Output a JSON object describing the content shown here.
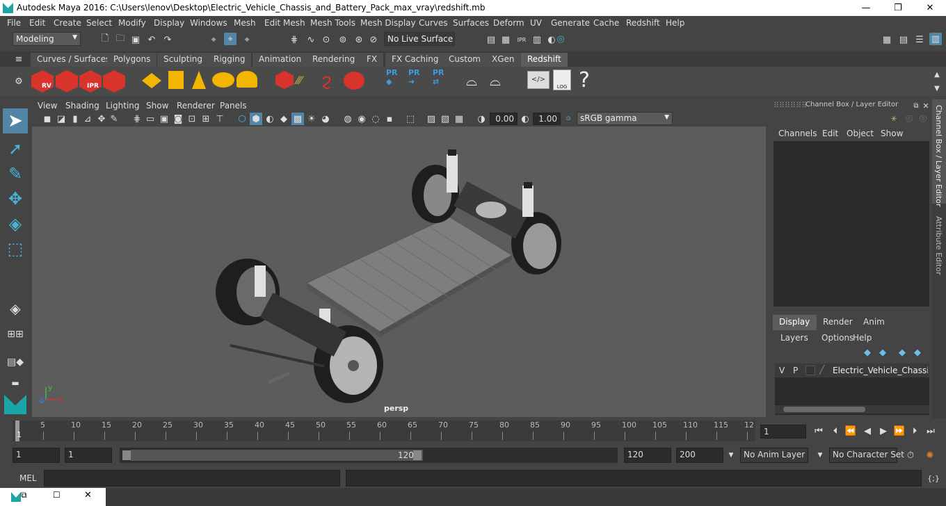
{
  "window": {
    "title": "Autodesk Maya 2016: C:\\Users\\lenov\\Desktop\\Electric_Vehicle_Chassis_and_Battery_Pack_max_vray\\redshift.mb"
  },
  "menubar": [
    "File",
    "Edit",
    "Create",
    "Select",
    "Modify",
    "Display",
    "Windows",
    "Mesh",
    "Edit Mesh",
    "Mesh Tools",
    "Mesh Display",
    "Curves",
    "Surfaces",
    "Deform",
    "UV",
    "Generate",
    "Cache",
    "Redshift",
    "Help"
  ],
  "status": {
    "mode": "Modeling",
    "live_surface": "No Live Surface"
  },
  "shelf_tabs": [
    "Curves / Surfaces",
    "Polygons",
    "Sculpting",
    "Rigging",
    "Animation",
    "Rendering",
    "FX",
    "FX Caching",
    "Custom",
    "XGen",
    "Redshift"
  ],
  "active_shelf": "Redshift",
  "shelf_icons": {
    "rv": "RV",
    "ipr": "IPR",
    "pr1": "PR",
    "pr2": "PR",
    "pr3": "PR",
    "log": "LOG",
    "help": "?"
  },
  "viewport": {
    "menu": [
      "View",
      "Shading",
      "Lighting",
      "Show",
      "Renderer",
      "Panels"
    ],
    "exposure": "0.00",
    "gamma": "1.00",
    "colorspace": "sRGB gamma",
    "camera": "persp"
  },
  "channel_box": {
    "title": "Channel Box / Layer Editor",
    "menu": [
      "Channels",
      "Edit",
      "Object",
      "Show"
    ],
    "layer_tabs": [
      "Display",
      "Render",
      "Anim"
    ],
    "active_layer_tab": "Display",
    "layer_menu": [
      "Layers",
      "Options",
      "Help"
    ],
    "layer": {
      "v": "V",
      "p": "P",
      "name": "Electric_Vehicle_Chassis_ar"
    }
  },
  "side_tabs": [
    "Channel Box / Layer Editor",
    "Attribute Editor"
  ],
  "timeline": {
    "ticks": [
      "5",
      "10",
      "15",
      "20",
      "25",
      "30",
      "35",
      "40",
      "45",
      "50",
      "55",
      "60",
      "65",
      "70",
      "75",
      "80",
      "85",
      "90",
      "95",
      "100",
      "105",
      "110",
      "115",
      "12"
    ],
    "current_frame_marker": "1",
    "current_frame": "1"
  },
  "range": {
    "start": "1",
    "playback_start": "1",
    "slider_start": "1",
    "slider_end": "120",
    "playback_end": "120",
    "end": "200",
    "anim_layer": "No Anim Layer",
    "character_set": "No Character Set"
  },
  "cmdline": {
    "label": "MEL"
  },
  "colors": {
    "accent": "#5285a6",
    "bg": "#444444",
    "viewport": "#5c5c5c",
    "rs_red": "#d9342b"
  }
}
